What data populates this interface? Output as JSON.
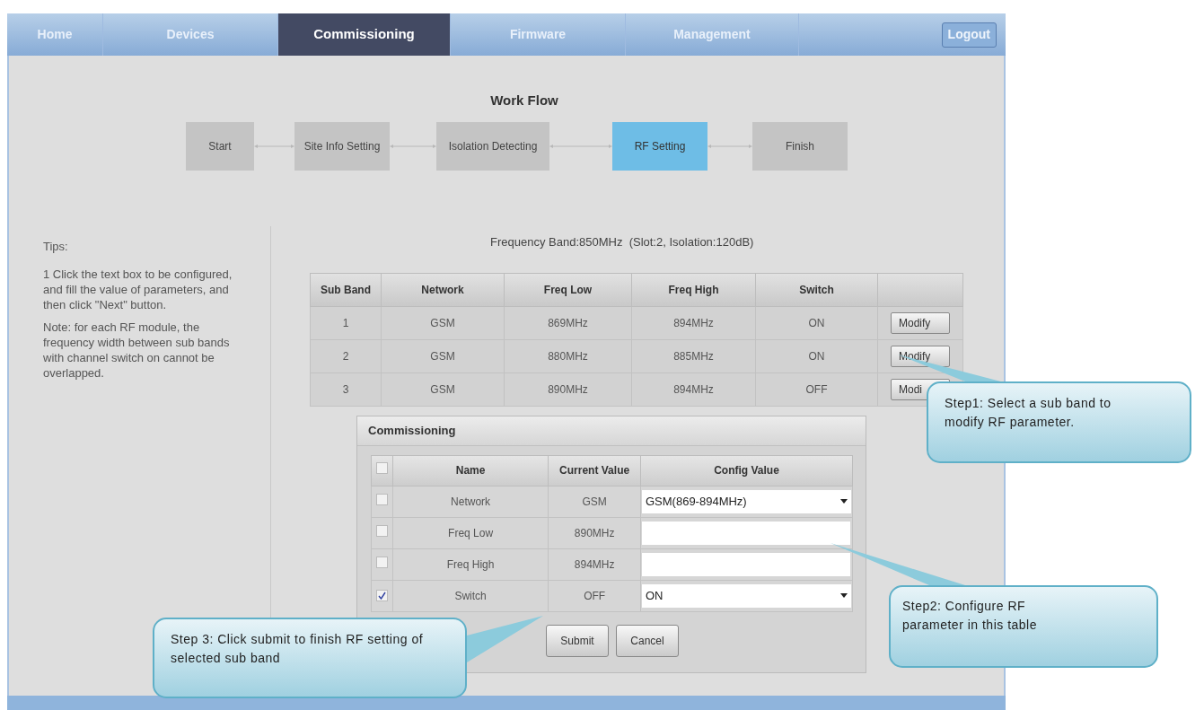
{
  "nav": {
    "tabs": [
      {
        "label": "Home",
        "selected": false
      },
      {
        "label": "Devices",
        "selected": false
      },
      {
        "label": "Commissioning",
        "selected": true
      },
      {
        "label": "Firmware",
        "selected": false
      },
      {
        "label": "Management",
        "selected": false
      }
    ],
    "logout": "Logout"
  },
  "workflow": {
    "title": "Work Flow",
    "steps": [
      {
        "label": "Start",
        "selected": false
      },
      {
        "label": "Site Info Setting",
        "selected": false
      },
      {
        "label": "Isolation Detecting",
        "selected": false
      },
      {
        "label": "RF Setting",
        "selected": true
      },
      {
        "label": "Finish",
        "selected": false
      }
    ]
  },
  "tips": {
    "title": "Tips:",
    "paragraphs": [
      "1 Click the text box to be configured, and fill the value of parameters, and then click \"Next\" button.",
      "Note: for each RF module, the frequency width between sub bands with channel switch on cannot be overlapped."
    ]
  },
  "band_info": "Frequency Band:850MHz  (Slot:2, Isolation:120dB)",
  "sub_bands": {
    "columns": [
      "Sub Band",
      "Network",
      "Freq Low",
      "Freq High",
      "Switch"
    ],
    "rows": [
      {
        "cells": [
          "1",
          "GSM",
          "869MHz",
          "894MHz",
          "ON"
        ],
        "action": "Modify"
      },
      {
        "cells": [
          "2",
          "GSM",
          "880MHz",
          "885MHz",
          "ON"
        ],
        "action": "Modify"
      },
      {
        "cells": [
          "3",
          "GSM",
          "890MHz",
          "894MHz",
          "OFF"
        ],
        "action": "Modi"
      }
    ]
  },
  "commissioning": {
    "title": "Commissioning",
    "header_checked": false,
    "columns": [
      "Name",
      "Current Value",
      "Config Value"
    ],
    "rows": [
      {
        "checked": false,
        "name": "Network",
        "current": "GSM",
        "kind": "select",
        "value": "GSM(869-894MHz)"
      },
      {
        "checked": false,
        "name": "Freq Low",
        "current": "890MHz",
        "kind": "text"
      },
      {
        "checked": false,
        "name": "Freq High",
        "current": "894MHz",
        "kind": "text"
      },
      {
        "checked": true,
        "name": "Switch",
        "current": "OFF",
        "kind": "select",
        "value": "ON"
      }
    ],
    "buttons": [
      "Submit",
      "Cancel"
    ]
  },
  "callouts": [
    {
      "text": "Step1: Select a sub band to modify RF parameter."
    },
    {
      "text": "Step2: Configure RF parameter in this table"
    },
    {
      "text": "Step 3: Click submit to finish RF setting of selected sub band"
    }
  ]
}
